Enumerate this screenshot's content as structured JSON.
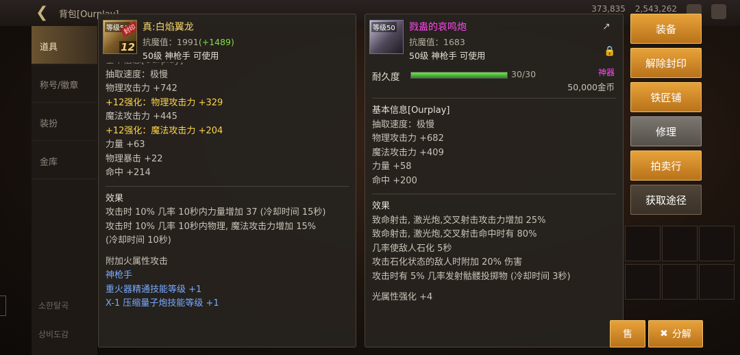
{
  "topbar": {
    "title": "背包[Ourplay]",
    "stat1": "373,835",
    "stat2": "2,543,262"
  },
  "sidebar": {
    "tabs": [
      "道具",
      "称号/徽章",
      "装扮",
      "金库"
    ],
    "rows": [
      "소한탈곡",
      "상비도감"
    ]
  },
  "item1": {
    "name": "真:白焰翼龙",
    "level_tag": "等级50",
    "seal_tag": "封印",
    "plus": "12",
    "resist_label": "抗魔值：1991",
    "resist_bonus": "(+1489)",
    "requirement": "50级 神枪手 可使用",
    "cut_header": "基本信息[Ourplay]",
    "stats": [
      {
        "text": "抽取速度：极慢",
        "style": "normal"
      },
      {
        "text": "物理攻击力 +742",
        "style": "normal"
      },
      {
        "text": "+12强化：物理攻击力 +329",
        "style": "yellow"
      },
      {
        "text": "魔法攻击力 +445",
        "style": "normal"
      },
      {
        "text": "+12强化：魔法攻击力 +204",
        "style": "yellow"
      },
      {
        "text": "力量 +63",
        "style": "normal"
      },
      {
        "text": "物理暴击 +22",
        "style": "normal"
      },
      {
        "text": "命中 +214",
        "style": "normal"
      }
    ],
    "effect_title": "效果",
    "effects": [
      "攻击时 10% 几率 10秒内力量增加 37 (冷却时间 15秒)",
      "攻击时 10% 几率 10秒内物理, 魔法攻击力增加 15%",
      "(冷却时间 10秒)"
    ],
    "extra": [
      {
        "text": "附加火属性攻击",
        "style": "normal"
      },
      {
        "text": "神枪手",
        "style": "blue"
      },
      {
        "text": "重火器精通技能等级 +1",
        "style": "blue"
      },
      {
        "text": "X-1 压缩量子炮技能等级 +1",
        "style": "blue"
      }
    ]
  },
  "item2": {
    "name": "戮蛊的哀鸣炮",
    "level_tag": "等级50",
    "resist_label": "抗魔值：1683",
    "requirement": "50级 神枪手 可使用",
    "durability_label": "耐久度",
    "durability_value": "30/30",
    "durability_fraction": 1.0,
    "rarity": "神器",
    "price": "50,000金币",
    "basic_title": "基本信息[Ourplay]",
    "stats": [
      "抽取速度：极慢",
      "物理攻击力 +682",
      "魔法攻击力 +409",
      "力量 +58",
      "命中 +200"
    ],
    "effect_title": "效果",
    "effects": [
      "致命射击, 激光炮,交叉射击攻击力增加 25%",
      "致命射击, 激光炮,交叉射击命中时有 80%",
      "几率使敌人石化 5秒",
      "攻击石化状态的敌人时附加 20% 伤害",
      "攻击时有 5% 几率发射骷髅投掷物 (冷却时间 3秒)"
    ],
    "element": "光属性强化 +4"
  },
  "actions": [
    "装备",
    "解除封印",
    "铁匠铺",
    "修理",
    "拍卖行",
    "获取途径"
  ],
  "bottom": {
    "sell": "售",
    "decompose": "分解"
  },
  "colors": {
    "gold": "#f5d76e",
    "epic": "#ff49f0",
    "green": "#7fe04a",
    "blue": "#78aaff",
    "button": "#e8a23a"
  }
}
